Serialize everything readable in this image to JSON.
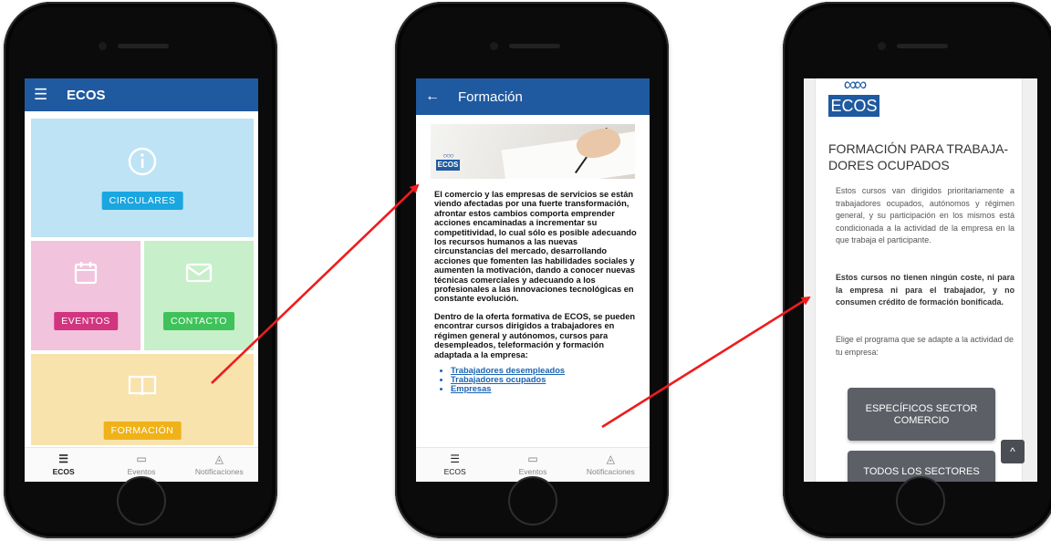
{
  "screen1": {
    "app_title": "ECOS",
    "tiles": {
      "circulares": "CIRCULARES",
      "eventos": "EVENTOS",
      "contacto": "CONTACTO",
      "formacion": "FORMACIÓN"
    },
    "nav": [
      "ECOS",
      "Eventos",
      "Notificaciones"
    ]
  },
  "screen2": {
    "title": "Formación",
    "logo_text": "ECOS",
    "para1": "El comercio y las empresas de servicios se están viendo afectadas por una fuerte transformación, afrontar estos cambios comporta emprender acciones encaminadas a incrementar su competitividad, lo cual sólo es posible adecuando los recursos humanos a las nuevas circunstancias del mercado, desarrollando acciones que fomenten las habilidades sociales y aumenten la motivación, dando a conocer nuevas técnicas comerciales y adecuando a los profesionales a las innovaciones tecnológicas en constante evolución.",
    "para2": "Dentro de la oferta formativa de ECOS, se pueden encontrar cursos dirigidos a trabajadores en régimen general y autónomos, cursos para desempleados, teleformación y formación adaptada a la empresa:",
    "links": [
      "Trabajadores desempleados",
      "Trabajadores ocupados",
      "Empresas"
    ],
    "nav": [
      "ECOS",
      "Eventos",
      "Notificaciones"
    ]
  },
  "screen3": {
    "logo_text": "ECOS",
    "heading": "FORMACIÓN PARA TRABAJA-DORES OCUPADOS",
    "para1": "Estos cursos van dirigidos prioritariamente a trabajadores ocupados, autónomos y régimen general, y su participación en los mismos está condicionada a la actividad de la empresa en la que trabaja el participante.",
    "para2": "Estos cursos no tienen ningún coste, ni para la empresa ni para el trabajador, y no consumen crédito de formación bonificada.",
    "para3": "Elige el programa que se adapte a la actividad de tu empresa:",
    "button1": "ESPECÍFICOS SECTOR COMERCIO",
    "button2": "TODOS LOS SECTORES"
  },
  "colors": {
    "appbar": "#1f5aa0",
    "arrow": "#ee1c1c",
    "circulares": "#1aa6e0",
    "eventos": "#d1357f",
    "contacto": "#3fc25a",
    "formacion": "#f0b21a"
  }
}
